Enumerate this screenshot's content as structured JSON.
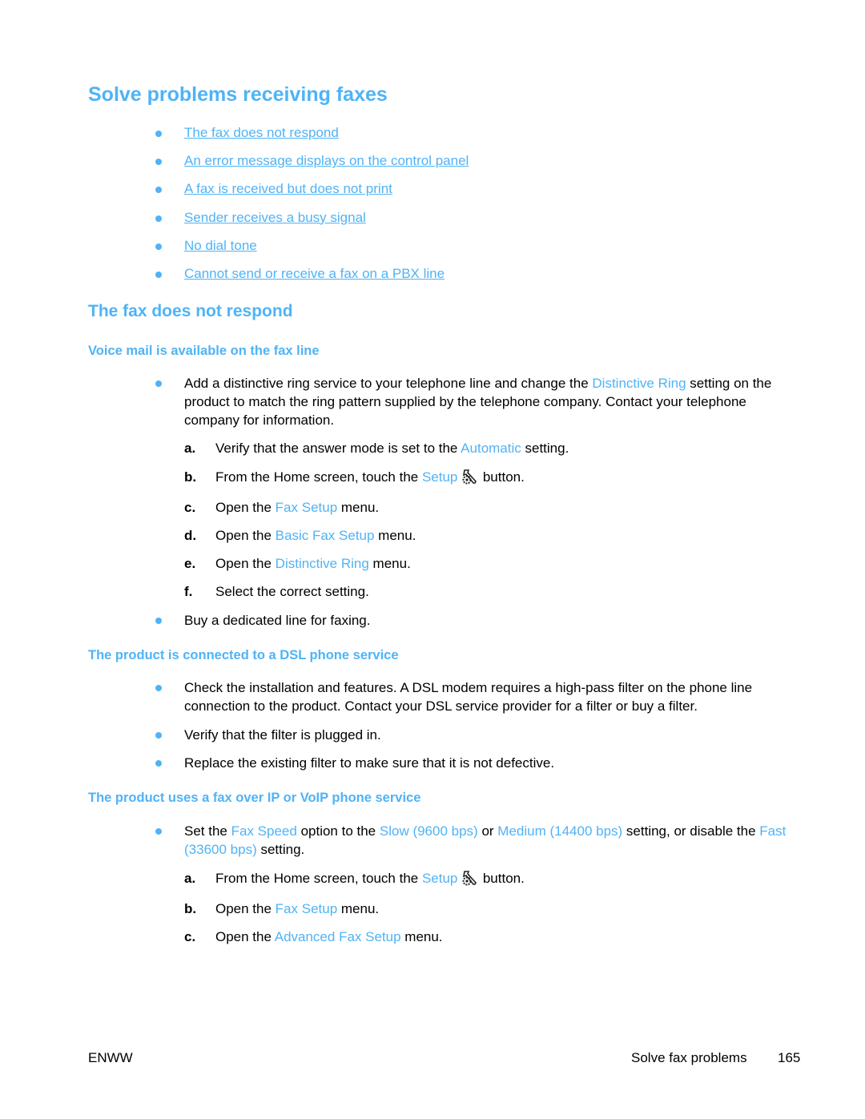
{
  "title": "Solve problems receiving faxes",
  "toc": [
    "The fax does not respond",
    "An error message displays on the control panel",
    "A fax is received but does not print",
    "Sender receives a busy signal",
    "No dial tone",
    "Cannot send or receive a fax on a PBX line"
  ],
  "section": {
    "heading": "The fax does not respond",
    "voicemail": {
      "heading": "Voice mail is available on the fax line",
      "bullet1": {
        "pre": "Add a distinctive ring service to your telephone line and change the ",
        "term": "Distinctive Ring",
        "post": " setting on the product to match the ring pattern supplied by the telephone company. Contact your telephone company for information."
      },
      "steps": [
        {
          "label": "a.",
          "pre": "Verify that the answer mode is set to the ",
          "term": "Automatic",
          "post": " setting."
        },
        {
          "label": "b.",
          "pre": "From the Home screen, touch the ",
          "term": "Setup",
          "post": " button."
        },
        {
          "label": "c.",
          "pre": "Open the ",
          "term": "Fax Setup",
          "post": " menu."
        },
        {
          "label": "d.",
          "pre": "Open the ",
          "term": "Basic Fax Setup",
          "post": " menu."
        },
        {
          "label": "e.",
          "pre": "Open the ",
          "term": "Distinctive Ring",
          "post": " menu."
        },
        {
          "label": "f.",
          "pre": "Select the correct setting.",
          "term": "",
          "post": ""
        }
      ],
      "bullet2": "Buy a dedicated line for faxing."
    },
    "dsl": {
      "heading": "The product is connected to a DSL phone service",
      "bullets": [
        "Check the installation and features. A DSL modem requires a high-pass filter on the phone line connection to the product. Contact your DSL service provider for a filter or buy a filter.",
        "Verify that the filter is plugged in.",
        "Replace the existing filter to make sure that it is not defective."
      ]
    },
    "voip": {
      "heading": "The product uses a fax over IP or VoIP phone service",
      "bullet": {
        "t1": "Set the ",
        "k1": "Fax Speed",
        "t2": " option to the ",
        "k2": "Slow (9600 bps)",
        "t3": " or ",
        "k3": "Medium (14400 bps)",
        "t4": " setting, or disable the ",
        "k4": "Fast (33600 bps)",
        "t5": " setting."
      },
      "steps": [
        {
          "label": "a.",
          "pre": "From the Home screen, touch the ",
          "term": "Setup",
          "post": " button."
        },
        {
          "label": "b.",
          "pre": "Open the ",
          "term": "Fax Setup",
          "post": " menu."
        },
        {
          "label": "c.",
          "pre": "Open the ",
          "term": "Advanced Fax Setup",
          "post": " menu."
        }
      ]
    }
  },
  "footer": {
    "left": "ENWW",
    "section": "Solve fax problems",
    "page": "165"
  },
  "colors": {
    "accent": "#4fb3f6"
  }
}
